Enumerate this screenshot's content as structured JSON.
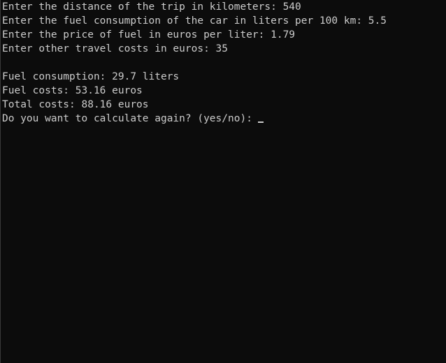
{
  "console": {
    "prompts": [
      "Enter the distance of the trip in kilometers: 540",
      "Enter the fuel consumption of the car in liters per 100 km: 5.5",
      "Enter the price of fuel in euros per liter: 1.79",
      "Enter other travel costs in euros: 35"
    ],
    "results": [
      "Fuel consumption: 29.7 liters",
      "Fuel costs: 53.16 euros",
      "Total costs: 88.16 euros"
    ],
    "question": "Do you want to calculate again? (yes/no):"
  }
}
